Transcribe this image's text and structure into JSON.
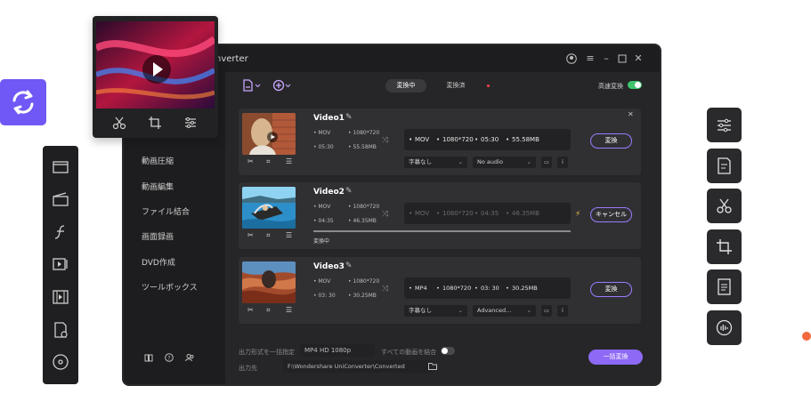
{
  "window": {
    "title_fragment": "nverter",
    "tabs": [
      {
        "label": "変換中",
        "active": true
      },
      {
        "label": "変換済",
        "active": false
      }
    ],
    "highspeed_label": "高速変換",
    "highspeed_on": true
  },
  "sidebar": {
    "items": [
      {
        "label": "動画圧縮"
      },
      {
        "label": "動画編集"
      },
      {
        "label": "ファイル結合"
      },
      {
        "label": "画面録画"
      },
      {
        "label": "DVD作成"
      },
      {
        "label": "ツールボックス"
      }
    ]
  },
  "videos": [
    {
      "name": "Video1",
      "src_format": "MOV",
      "src_res": "1080*720",
      "src_dur": "05:30",
      "src_size": "55.58MB",
      "out_format": "MOV",
      "out_res": "1080*720",
      "out_dur": "05:30",
      "out_size": "55.58MB",
      "subtitle": "字幕なし",
      "audio": "No audio",
      "button": "変換"
    },
    {
      "name": "Video2",
      "src_format": "MOV",
      "src_res": "1080*720",
      "src_dur": "04:35",
      "src_size": "46.35MB",
      "out_format": "MOV",
      "out_res": "1080*720",
      "out_dur": "04:35",
      "out_size": "46.35MB",
      "status": "変換中",
      "button": "キャンセル"
    },
    {
      "name": "Video3",
      "src_format": "MOV",
      "src_res": "1080*720",
      "src_dur": "03: 30",
      "src_size": "30.25MB",
      "out_format": "MP4",
      "out_res": "1080*720",
      "out_dur": "03: 30",
      "out_size": "30.25MB",
      "subtitle": "字幕なし",
      "audio": "Advanced...",
      "button": "変換"
    }
  ],
  "footer": {
    "format_label": "出力形式を一括指定",
    "format_value": "MP4 HD 1080p",
    "merge_label": "すべての動画を結合",
    "merge_on": false,
    "dest_label": "出力先",
    "dest_value": "F:\\Wondershare UniConverter\\Converted",
    "batch_button": "一括変換"
  },
  "colors": {
    "accent": "#8d69f5",
    "toggle_on": "#3ec46d",
    "sync_button": "#6f58f5",
    "status_dot": "#f26a3d"
  }
}
